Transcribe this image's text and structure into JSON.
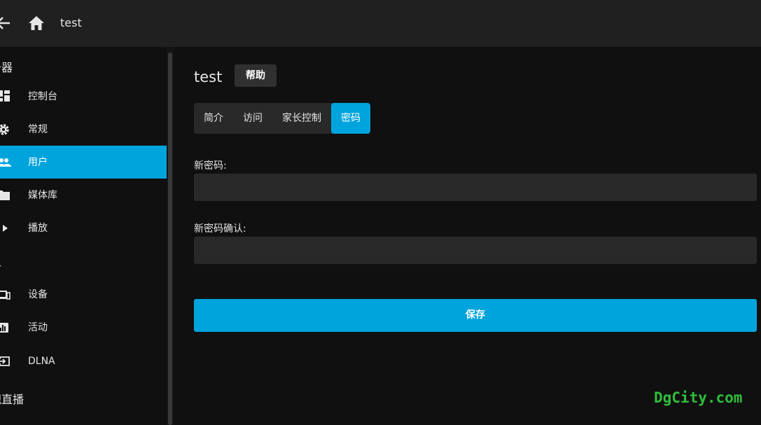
{
  "header": {
    "title": "test",
    "back_icon": "arrow-left-icon",
    "home_icon": "home-icon"
  },
  "sidebar": {
    "sections": [
      {
        "label": "务器"
      },
      {
        "label": "备"
      },
      {
        "label": "视直播"
      }
    ],
    "items": [
      {
        "label": "控制台",
        "icon": "dashboard-icon"
      },
      {
        "label": "常规",
        "icon": "gear-icon"
      },
      {
        "label": "用户",
        "icon": "people-icon",
        "active": true
      },
      {
        "label": "媒体库",
        "icon": "folder-icon"
      },
      {
        "label": "播放",
        "icon": "play-icon"
      },
      {
        "label": "设备",
        "icon": "devices-icon"
      },
      {
        "label": "活动",
        "icon": "activity-chart-icon"
      },
      {
        "label": "DLNA",
        "icon": "input-icon"
      }
    ]
  },
  "main": {
    "title": "test",
    "help_label": "帮助",
    "tabs": [
      {
        "label": "简介"
      },
      {
        "label": "访问"
      },
      {
        "label": "家长控制"
      },
      {
        "label": "密码",
        "active": true
      }
    ],
    "new_password_label": "新密码:",
    "new_password_value": "",
    "confirm_password_label": "新密码确认:",
    "confirm_password_value": "",
    "save_label": "保存"
  },
  "watermark": "DgCity.com",
  "colors": {
    "accent": "#00a4dc",
    "background": "#101010",
    "header": "#202020",
    "input": "#292929",
    "watermark": "#2fbd3b"
  }
}
